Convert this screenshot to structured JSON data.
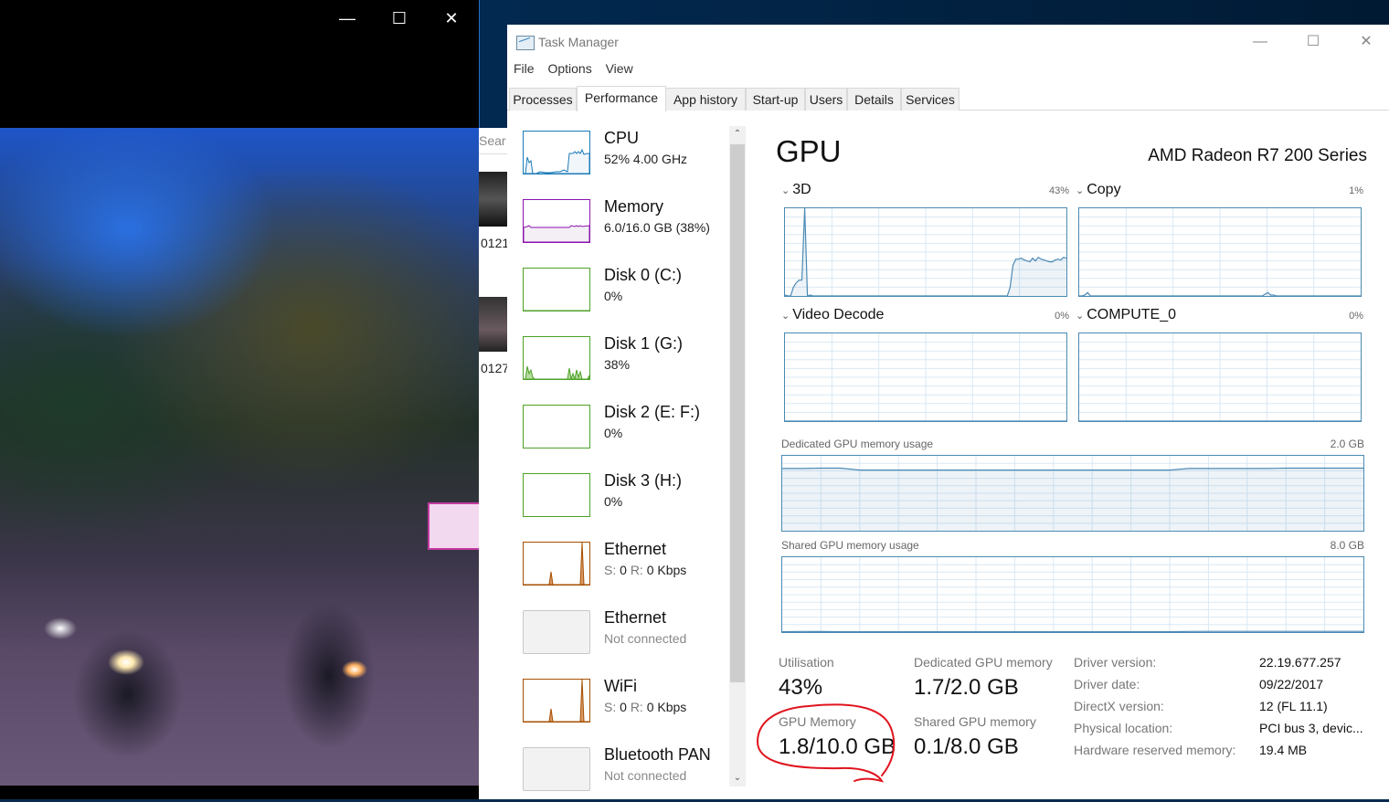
{
  "viewer": {
    "controls": {
      "minimize": "—",
      "maximize": "☐",
      "close": "✕"
    },
    "behind_window": {
      "search_placeholder": "Sear",
      "captions": [
        "0121",
        "0127"
      ]
    }
  },
  "task_manager": {
    "title": "Task Manager",
    "window_controls": {
      "minimize": "—",
      "maximize": "☐",
      "close": "✕"
    },
    "menu": [
      "File",
      "Options",
      "View"
    ],
    "tabs": [
      "Processes",
      "Performance",
      "App history",
      "Start-up",
      "Users",
      "Details",
      "Services"
    ],
    "active_tab": "Performance",
    "sidebar": [
      {
        "name": "CPU",
        "value": "52% 4.00 GHz",
        "color": "#1a7ab8",
        "fill": "#f1f6fb"
      },
      {
        "name": "Memory",
        "value": "6.0/16.0 GB (38%)",
        "color": "#8b12ae",
        "fill": "#f3eff5"
      },
      {
        "name": "Disk 0 (C:)",
        "value": "0%",
        "color": "#4da127",
        "fill": "#eff7eb"
      },
      {
        "name": "Disk 1 (G:)",
        "value": "38%",
        "color": "#4da127",
        "fill": "#eff7eb"
      },
      {
        "name": "Disk 2 (E: F:)",
        "value": "0%",
        "color": "#4da127",
        "fill": "#eff7eb"
      },
      {
        "name": "Disk 3 (H:)",
        "value": "0%",
        "color": "#4da127",
        "fill": "#eff7eb"
      },
      {
        "name": "Ethernet",
        "value_s": "S:",
        "value_s_num": "0",
        "value_r": "R:",
        "value_r_num": "0 Kbps",
        "color": "#a74f01"
      },
      {
        "name": "Ethernet",
        "value": "Not connected",
        "disabled": true
      },
      {
        "name": "WiFi",
        "value_s": "S:",
        "value_s_num": "0",
        "value_r": "R:",
        "value_r_num": "0 Kbps",
        "color": "#a74f01"
      },
      {
        "name": "Bluetooth PAN",
        "value": "Not connected",
        "disabled": true
      }
    ],
    "scrollbar": {
      "up": "⌃",
      "down": "⌄"
    },
    "gpu": {
      "title": "GPU",
      "model": "AMD Radeon R7 200 Series",
      "accent": "#4b8ab4",
      "engines": [
        {
          "label": "3D",
          "percent": "43%"
        },
        {
          "label": "Copy",
          "percent": "1%"
        },
        {
          "label": "Video Decode",
          "percent": "0%"
        },
        {
          "label": "COMPUTE_0",
          "percent": "0%"
        }
      ],
      "dedicated_usage": {
        "label": "Dedicated GPU memory usage",
        "max": "2.0 GB"
      },
      "shared_usage": {
        "label": "Shared GPU memory usage",
        "max": "8.0 GB"
      },
      "stats": {
        "utilisation_label": "Utilisation",
        "utilisation_value": "43%",
        "dedicated_label": "Dedicated GPU memory",
        "dedicated_value": "1.7/2.0 GB",
        "gpu_memory_label": "GPU Memory",
        "gpu_memory_value": "1.8/10.0 GB",
        "shared_label": "Shared GPU memory",
        "shared_value": "0.1/8.0 GB"
      },
      "info": [
        {
          "label": "Driver version:",
          "value": "22.19.677.257"
        },
        {
          "label": "Driver date:",
          "value": "09/22/2017"
        },
        {
          "label": "DirectX version:",
          "value": "12 (FL 11.1)"
        },
        {
          "label": "Physical location:",
          "value": "PCI bus 3, devic..."
        },
        {
          "label": "Hardware reserved memory:",
          "value": "19.4 MB"
        }
      ],
      "annotation_color": "#e0141e"
    }
  },
  "chart_data": [
    {
      "type": "area",
      "title": "3D",
      "ylim": [
        0,
        100
      ],
      "unit": "%",
      "values": [
        1,
        0,
        0,
        10,
        15,
        18,
        18,
        100,
        0,
        1,
        0,
        0,
        0,
        0,
        0,
        0,
        0,
        0,
        0,
        0,
        0,
        0,
        0,
        0,
        0,
        0,
        0,
        0,
        0,
        0,
        0,
        0,
        0,
        0,
        0,
        0,
        0,
        0,
        0,
        0,
        0,
        0,
        0,
        0,
        0,
        0,
        0,
        0,
        0,
        0,
        0,
        0,
        0,
        0,
        0,
        0,
        0,
        0,
        0,
        0,
        0,
        0,
        0,
        0,
        0,
        0,
        0,
        0,
        0,
        0,
        0,
        0,
        0,
        0,
        0,
        0,
        0,
        0,
        0,
        0,
        10,
        35,
        42,
        42,
        43,
        41,
        40,
        39,
        43,
        40,
        44,
        42,
        41,
        40,
        39,
        39,
        41,
        42,
        41,
        44,
        43
      ]
    },
    {
      "type": "area",
      "title": "Copy",
      "ylim": [
        0,
        100
      ],
      "unit": "%",
      "values": [
        0,
        0,
        1,
        4,
        0,
        0,
        0,
        0,
        0,
        0,
        0,
        0,
        0,
        0,
        0,
        0,
        0,
        0,
        0,
        0,
        0,
        0,
        0,
        0,
        0,
        0,
        0,
        0,
        0,
        0,
        0,
        0,
        0,
        0,
        0,
        0,
        0,
        0,
        0,
        0,
        0,
        0,
        0,
        0,
        0,
        0,
        0,
        0,
        0,
        0,
        0,
        0,
        0,
        0,
        0,
        0,
        0,
        0,
        0,
        0,
        0,
        0,
        0,
        0,
        0,
        0,
        2,
        4,
        1,
        1,
        0,
        0,
        0,
        0,
        0,
        0,
        0,
        0,
        0,
        0,
        0,
        0,
        0,
        0,
        0,
        0,
        0,
        0,
        0,
        0,
        0,
        0,
        0,
        0,
        0,
        0,
        0,
        0,
        0,
        0,
        0
      ]
    },
    {
      "type": "area",
      "title": "Video Decode",
      "ylim": [
        0,
        100
      ],
      "unit": "%",
      "values": [
        0,
        0
      ]
    },
    {
      "type": "area",
      "title": "COMPUTE_0",
      "ylim": [
        0,
        100
      ],
      "unit": "%",
      "values": [
        0,
        0
      ]
    },
    {
      "type": "area",
      "title": "Dedicated GPU memory usage",
      "ylim": [
        0,
        2.0
      ],
      "unit": "GB",
      "values": [
        1.66,
        1.66,
        1.67,
        1.67,
        1.62,
        1.62,
        1.62,
        1.62,
        1.62,
        1.62,
        1.62,
        1.62,
        1.62,
        1.62,
        1.62,
        1.62,
        1.62,
        1.62,
        1.62,
        1.62,
        1.62,
        1.66,
        1.66,
        1.66,
        1.66,
        1.66,
        1.67,
        1.67,
        1.67,
        1.67,
        1.67
      ]
    },
    {
      "type": "area",
      "title": "Shared GPU memory usage",
      "ylim": [
        0,
        8.0
      ],
      "unit": "GB",
      "values": [
        0.04,
        0.07,
        0.06,
        0.04,
        0.04,
        0.04,
        0.04,
        0.04,
        0.04,
        0.04,
        0.04,
        0.04,
        0.04,
        0.04,
        0.04,
        0.04,
        0.04,
        0.04,
        0.04,
        0.04,
        0.04,
        0.07,
        0.08,
        0.08,
        0.08,
        0.08,
        0.08,
        0.08,
        0.08,
        0.08,
        0.08
      ]
    }
  ]
}
